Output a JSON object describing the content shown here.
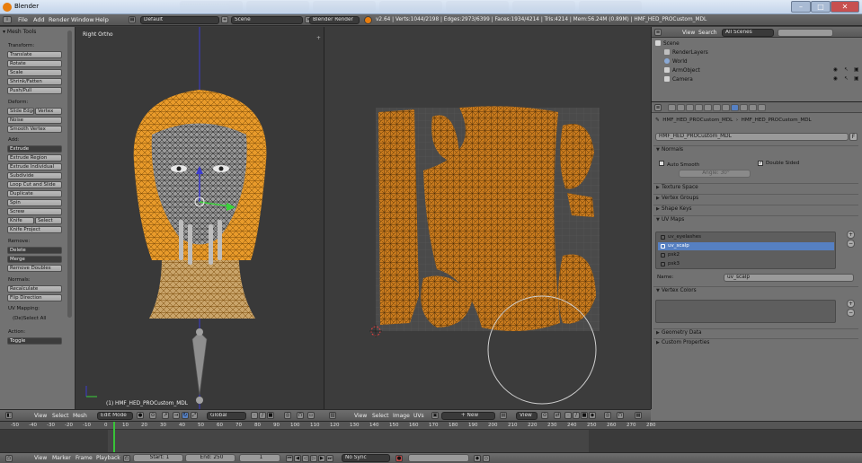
{
  "titlebar": {
    "title": "Blender"
  },
  "infobar": {
    "menus": [
      "File",
      "Add",
      "Render",
      "Window",
      "Help"
    ],
    "screen_layout": "Default",
    "scene": "Scene",
    "render_engine": "Blender Render",
    "stats": "v2.64 | Verts:1044/2198 | Edges:2973/6399 | Faces:1934/4214 | Tris:4214 | Mem:56.24M (0.89M) | HMF_HED_PROCustom_MDL"
  },
  "toolshelf": {
    "header": "Mesh Tools",
    "sections": [
      {
        "label": "Transform:",
        "buttons": [
          "Translate",
          "Rotate",
          "Scale",
          "Shrink/Fatten",
          "Push/Pull"
        ]
      },
      {
        "label": "Deform:",
        "buttons": [
          "Slide Edge",
          "Vertex",
          "Noise",
          "Smooth Vertex"
        ]
      },
      {
        "label": "Add:",
        "buttons": [
          "Extrude",
          "Extrude Region",
          "Extrude Individual",
          "Subdivide",
          "Loop Cut and Slide",
          "Duplicate",
          "Spin",
          "Screw",
          "Knife",
          "Select",
          "Knife Project"
        ]
      },
      {
        "label": "Remove:",
        "buttons": [
          "Delete",
          "Merge",
          "Remove Doubles"
        ]
      },
      {
        "label": "Normals:",
        "buttons": [
          "Recalculate",
          "Flip Direction"
        ]
      },
      {
        "label": "UV Mapping:",
        "buttons": []
      },
      {
        "label": "(De)Select All",
        "buttons": []
      },
      {
        "label": "Action:",
        "buttons": [
          "Toggle"
        ]
      }
    ]
  },
  "viewport": {
    "view_label": "Right Ortho",
    "object_label": "(1) HMF_HED_PROCustom_MDL",
    "header": {
      "menus": [
        "View",
        "Select",
        "Mesh"
      ],
      "mode": "Edit Mode",
      "orientation": "Global"
    }
  },
  "uv_editor": {
    "header": {
      "menus": [
        "View",
        "Select",
        "Image",
        "UVs"
      ],
      "image_button": "New",
      "view_dropdown": "View"
    }
  },
  "outliner": {
    "header": {
      "menus": [
        "View",
        "Search"
      ],
      "filter": "All Scenes"
    },
    "rows": [
      {
        "label": "Scene",
        "indent": 0
      },
      {
        "label": "RenderLayers",
        "indent": 1
      },
      {
        "label": "World",
        "indent": 1
      },
      {
        "label": "ArmObject",
        "indent": 1
      },
      {
        "label": "Camera",
        "indent": 1
      }
    ]
  },
  "properties": {
    "breadcrumb": [
      "HMF_HED_PROCustom_MDL",
      "HMF_HED_PROCustom_MDL"
    ],
    "mesh_name": "HMF_HED_PROCustom_MDL",
    "mesh_fake_user": "F",
    "normals_panel": "Normals",
    "auto_smooth": "Auto Smooth",
    "double_sided": "Double Sided",
    "angle_field": "Angle: 30°",
    "panels": [
      "Texture Space",
      "Vertex Groups",
      "Shape Keys",
      "UV Maps"
    ],
    "uv_maps": [
      "uv_eyelashes",
      "uv_scalp",
      "psk2",
      "psk3"
    ],
    "uv_selected": "uv_scalp",
    "name_label": "Name:",
    "name_value": "uv_scalp",
    "vertex_colors": "Vertex Colors",
    "geometry_data": "Geometry Data",
    "custom_properties": "Custom Properties"
  },
  "timeline": {
    "ticks": [
      "-50",
      "-40",
      "-30",
      "-20",
      "-10",
      "0",
      "10",
      "20",
      "30",
      "40",
      "50",
      "60",
      "70",
      "80",
      "90",
      "100",
      "110",
      "120",
      "130",
      "140",
      "150",
      "160",
      "170",
      "180",
      "190",
      "200",
      "210",
      "220",
      "230",
      "240",
      "250",
      "260",
      "270",
      "280"
    ],
    "current_frame": "1",
    "menus": [
      "View",
      "Marker",
      "Frame",
      "Playback"
    ],
    "start": "Start: 1",
    "end": "End: 250",
    "sync": "No Sync"
  },
  "colors": {
    "uv_fill": "#c87a1e",
    "selected_vertex": "#ff9b1a",
    "ui_gray": "#727272",
    "selection_blue": "#5680c2"
  }
}
